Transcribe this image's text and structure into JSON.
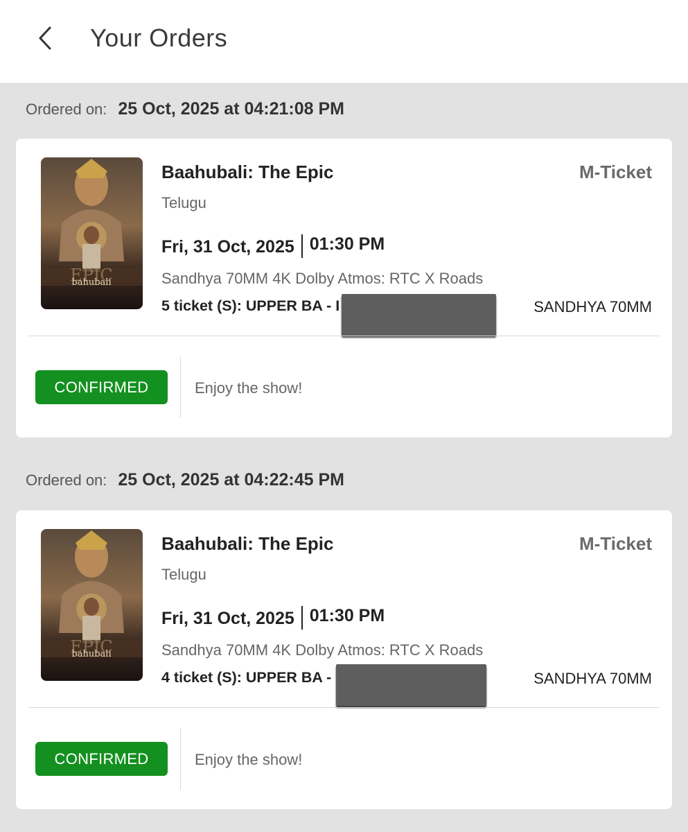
{
  "header": {
    "title": "Your Orders",
    "back_icon": "chevron-left-icon"
  },
  "orders": [
    {
      "ordered_on_label": "Ordered on:",
      "ordered_on": "25 Oct, 2025 at 04:21:08 PM",
      "movie_title": "Baahubali: The Epic",
      "ticket_type": "M-Ticket",
      "language": "Telugu",
      "show_date": "Fri, 31 Oct, 2025",
      "show_time": "01:30 PM",
      "venue": "Sandhya 70MM 4K Dolby Atmos: RTC X Roads",
      "tickets": "5 ticket (S): UPPER BA - I",
      "screen": "SANDHYA 70MM",
      "status": "CONFIRMED",
      "status_message": "Enjoy the show!",
      "poster_text": "EPIC bahubali"
    },
    {
      "ordered_on_label": "Ordered on:",
      "ordered_on": "25 Oct, 2025 at 04:22:45 PM",
      "movie_title": "Baahubali: The Epic",
      "ticket_type": "M-Ticket",
      "language": "Telugu",
      "show_date": "Fri, 31 Oct, 2025",
      "show_time": "01:30 PM",
      "venue": "Sandhya 70MM 4K Dolby Atmos: RTC X Roads",
      "tickets": "4 ticket (S): UPPER BA -",
      "screen": "SANDHYA 70MM",
      "status": "CONFIRMED",
      "status_message": "Enjoy the show!",
      "poster_text": "EPIC bahubali"
    }
  ],
  "colors": {
    "confirmed": "#13901f",
    "background": "#e2e2e2",
    "card": "#ffffff"
  }
}
